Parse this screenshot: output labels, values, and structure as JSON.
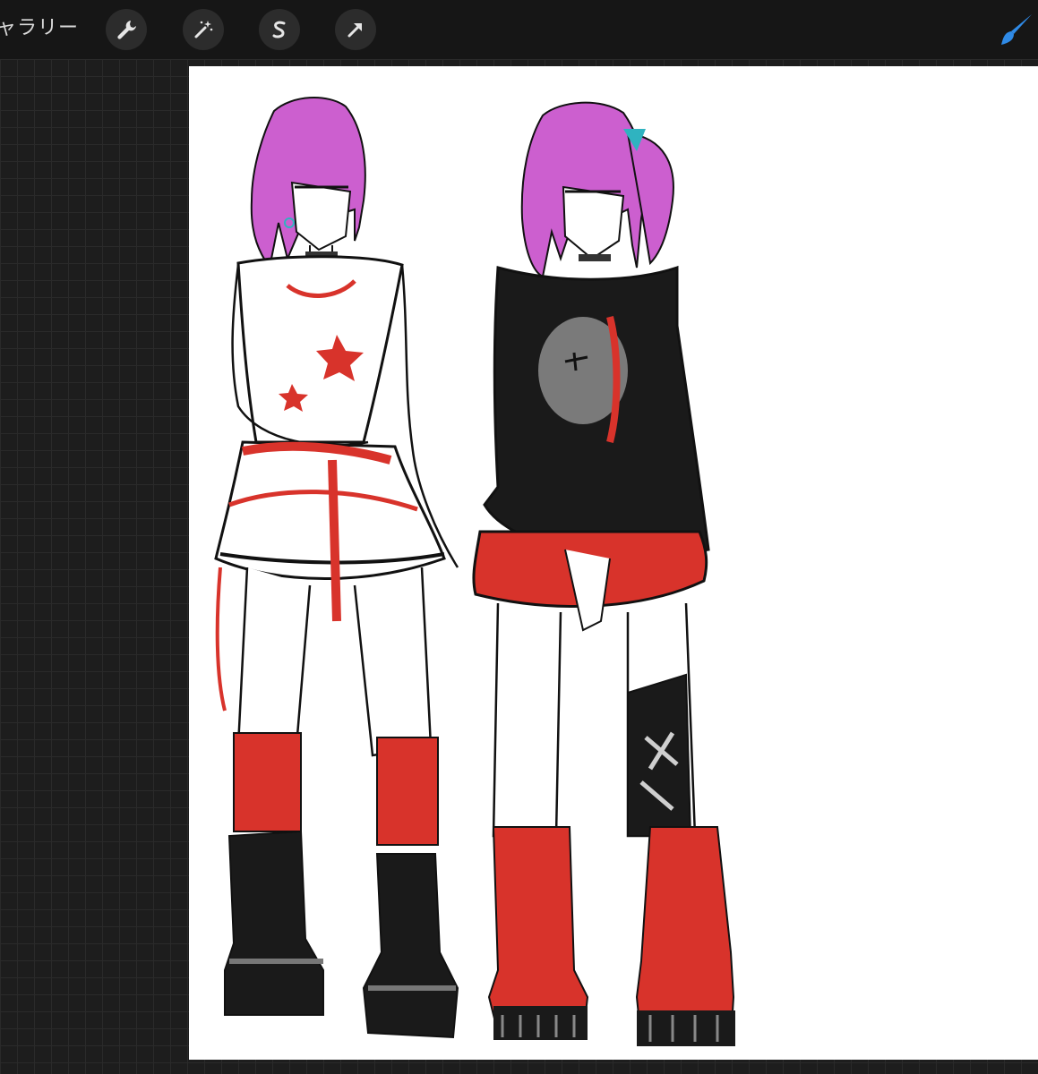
{
  "toolbar": {
    "gallery_label": "ャラリー",
    "tools": [
      {
        "name": "actions",
        "icon": "wrench-icon"
      },
      {
        "name": "adjustments",
        "icon": "magic-wand-icon"
      },
      {
        "name": "selection",
        "icon": "s-curve-icon"
      },
      {
        "name": "transform",
        "icon": "arrow-icon"
      }
    ],
    "active_tool": {
      "name": "brush",
      "icon": "paintbrush-icon"
    }
  },
  "colors": {
    "toolbar_bg": "#161616",
    "workspace_bg": "#1d1d1d",
    "canvas_bg": "#ffffff",
    "brush_accent": "#2f8ae6",
    "hair": "#cc5fcf",
    "red": "#d8332b",
    "black": "#1a1a1a",
    "teal": "#2fb3c0"
  }
}
